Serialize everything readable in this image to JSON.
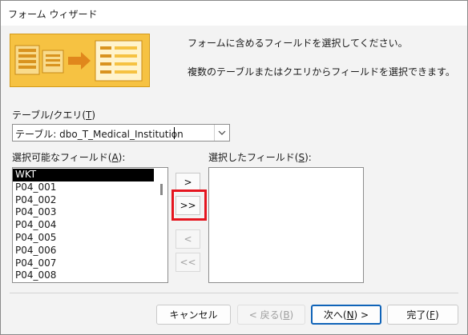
{
  "window": {
    "title": "フォーム ウィザード"
  },
  "instructions": {
    "line1": "フォームに含めるフィールドを選択してください。",
    "line2": "複数のテーブルまたはクエリからフィールドを選択できます。"
  },
  "table_query": {
    "label_prefix": "テーブル/クエリ(",
    "label_key": "T",
    "label_suffix": ")",
    "value": "テーブル: dbo_T_Medical_Institution"
  },
  "available_fields": {
    "label_prefix": "選択可能なフィールド(",
    "label_key": "A",
    "label_suffix": "):",
    "items": [
      "WKT",
      "P04_001",
      "P04_002",
      "P04_003",
      "P04_004",
      "P04_005",
      "P04_006",
      "P04_007",
      "P04_008"
    ],
    "selected": "WKT"
  },
  "selected_fields": {
    "label_prefix": "選択したフィールド(",
    "label_key": "S",
    "label_suffix": "):",
    "items": []
  },
  "move_buttons": {
    "add_one": ">",
    "add_all": ">>",
    "remove_one": "<",
    "remove_all": "<<"
  },
  "footer": {
    "cancel": "キャンセル",
    "back_prefix": "< 戻る(",
    "back_key": "B",
    "back_suffix": ")",
    "next_prefix": "次へ(",
    "next_key": "N",
    "next_suffix": ") >",
    "finish_prefix": "完了(",
    "finish_key": "F",
    "finish_suffix": ")"
  },
  "colors": {
    "highlight_box": "#e5151f",
    "illustration_bg": "#f6c242",
    "default_button_border": "#0f63b8"
  },
  "icons": {
    "illustration": "form-wizard-illustration",
    "combo_arrow": "chevron-down-icon"
  }
}
